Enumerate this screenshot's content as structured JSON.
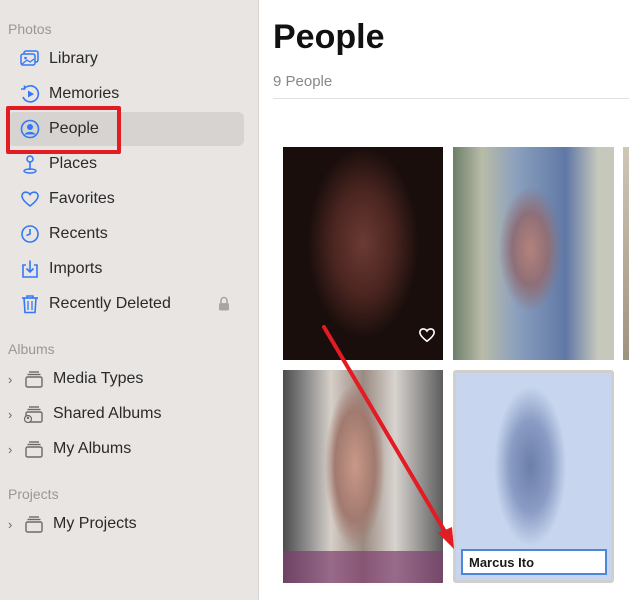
{
  "sidebar": {
    "sections": [
      {
        "title": "Photos"
      },
      {
        "title": "Albums"
      },
      {
        "title": "Projects"
      }
    ],
    "photos_items": [
      {
        "label": "Library",
        "icon": "library-icon"
      },
      {
        "label": "Memories",
        "icon": "memories-icon"
      },
      {
        "label": "People",
        "icon": "people-icon",
        "selected": true
      },
      {
        "label": "Places",
        "icon": "places-icon"
      },
      {
        "label": "Favorites",
        "icon": "heart-icon"
      },
      {
        "label": "Recents",
        "icon": "clock-icon"
      },
      {
        "label": "Imports",
        "icon": "import-icon"
      },
      {
        "label": "Recently Deleted",
        "icon": "trash-icon",
        "locked": true
      }
    ],
    "album_items": [
      {
        "label": "Media Types",
        "icon": "album-stack-icon"
      },
      {
        "label": "Shared Albums",
        "icon": "shared-album-icon"
      },
      {
        "label": "My Albums",
        "icon": "album-stack-icon"
      }
    ],
    "project_items": [
      {
        "label": "My Projects",
        "icon": "album-stack-icon"
      }
    ]
  },
  "main": {
    "title": "People",
    "count": "9 People",
    "name_input_value": "Marcus Ito"
  },
  "colors": {
    "accent": "#3478f6",
    "annotation_red": "#e31b23",
    "sidebar_bg": "#e8e5e3"
  }
}
